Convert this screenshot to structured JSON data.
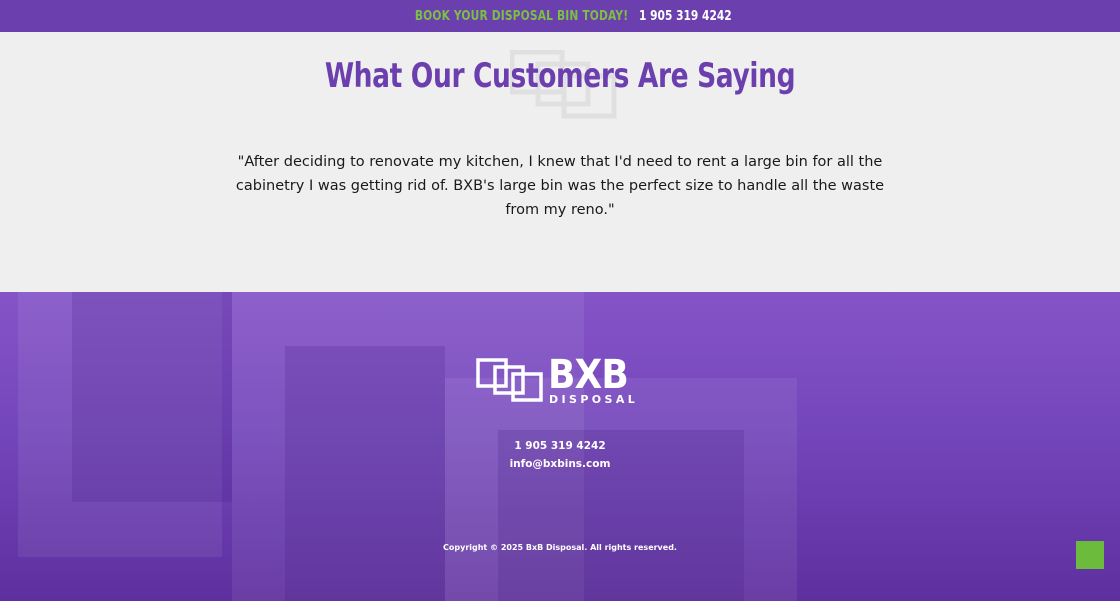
{
  "topbar": {
    "promo": "BOOK YOUR DISPOSAL BIN TODAY!",
    "phone": "1 905 319 4242",
    "promo_color": "#7bc043",
    "background": "#6c3fae"
  },
  "testimonials": {
    "title": "What Our Customers Are Saying",
    "quote": "\"After deciding to renovate my kitchen, I knew that I'd need to rent a large bin for all the cabinetry I was getting rid of. BXB's large bin was the perfect size to handle all the waste from my reno.\"",
    "title_color": "#6c3fae"
  },
  "footer": {
    "logo_word": "BXB",
    "logo_sub": "DISPOSAL",
    "phone": "1 905 319 4242",
    "email": "info@bxbins.com",
    "copyright": "Copyright © 2025 BxB Disposal. All rights reserved."
  },
  "scroll_top": {
    "icon": "scroll-to-top-icon",
    "color": "#6dbb3c"
  }
}
